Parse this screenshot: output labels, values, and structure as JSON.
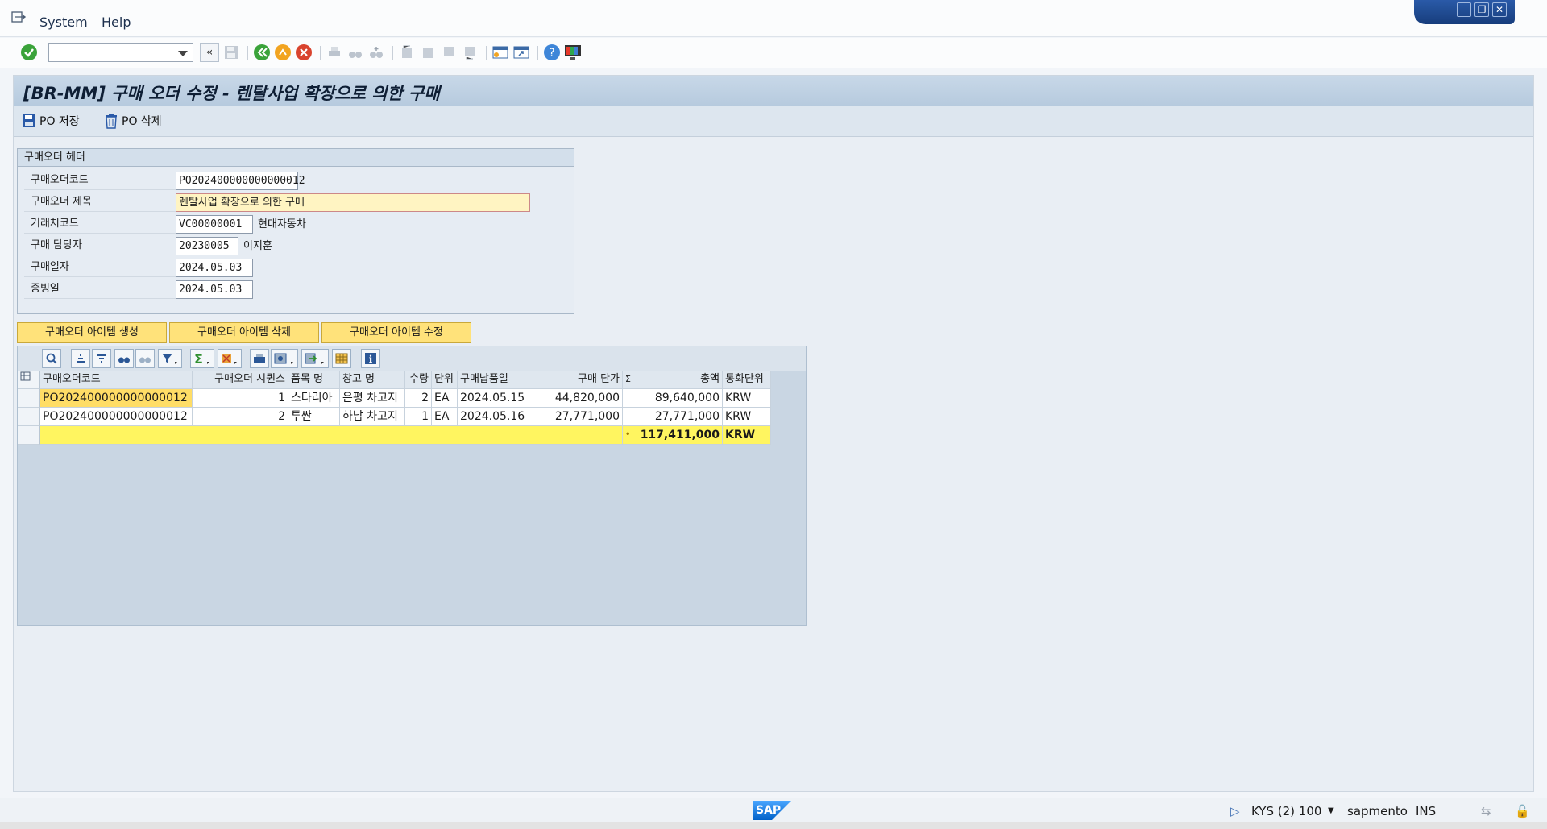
{
  "menu": {
    "system": "System",
    "help": "Help"
  },
  "window_controls": [
    "_",
    "❐",
    "✕"
  ],
  "title": "[BR-MM] 구매 오더 수정 - 렌탈사업 확장으로 의한 구매",
  "app_toolbar": {
    "save": "PO 저장",
    "delete": "PO 삭제"
  },
  "header": {
    "legend": "구매오더 헤더",
    "fields": {
      "po_code_label": "구매오더코드",
      "po_code_value": "PO202400000000000012",
      "po_title_label": "구매오더 제목",
      "po_title_value": "렌탈사업 확장으로 의한 구매",
      "vendor_label": "거래처코드",
      "vendor_value": "VC00000001",
      "vendor_name": "현대자동차",
      "buyer_label": "구매 담당자",
      "buyer_value": "20230005",
      "buyer_name": "이지훈",
      "po_date_label": "구매일자",
      "po_date_value": "2024.05.03",
      "doc_date_label": "증빙일",
      "doc_date_value": "2024.05.03"
    }
  },
  "item_buttons": {
    "create": "구매오더 아이템 생성",
    "delete": "구매오더 아이템 삭제",
    "edit": "구매오더 아이템 수정"
  },
  "grid": {
    "columns": [
      "구매오더코드",
      "구매오더 시퀀스",
      "품목 명",
      "창고 명",
      "수량",
      "단위",
      "구매납품일",
      "구매 단가",
      "총액",
      "통화단위"
    ],
    "sum_mark": "Σ",
    "rows": [
      {
        "code": "PO202400000000000012",
        "seq": "1",
        "item": "스타리아",
        "warehouse": "은평 차고지",
        "qty": "2",
        "unit": "EA",
        "delivery": "2024.05.15",
        "price": "44,820,000",
        "total": "89,640,000",
        "currency": "KRW"
      },
      {
        "code": "PO202400000000000012",
        "seq": "2",
        "item": "투싼",
        "warehouse": "하남 차고지",
        "qty": "1",
        "unit": "EA",
        "delivery": "2024.05.16",
        "price": "27,771,000",
        "total": "27,771,000",
        "currency": "KRW"
      }
    ],
    "sum_row": {
      "dot": "•",
      "total": "117,411,000",
      "currency": "KRW"
    }
  },
  "status": {
    "session": "KYS (2) 100",
    "user": "sapmento",
    "mode": "INS",
    "logo": "SAP"
  },
  "colors": {
    "title_bg": "#c8d8e8",
    "sum_row": "#fff560",
    "button_yellow": "#ffe27a"
  }
}
